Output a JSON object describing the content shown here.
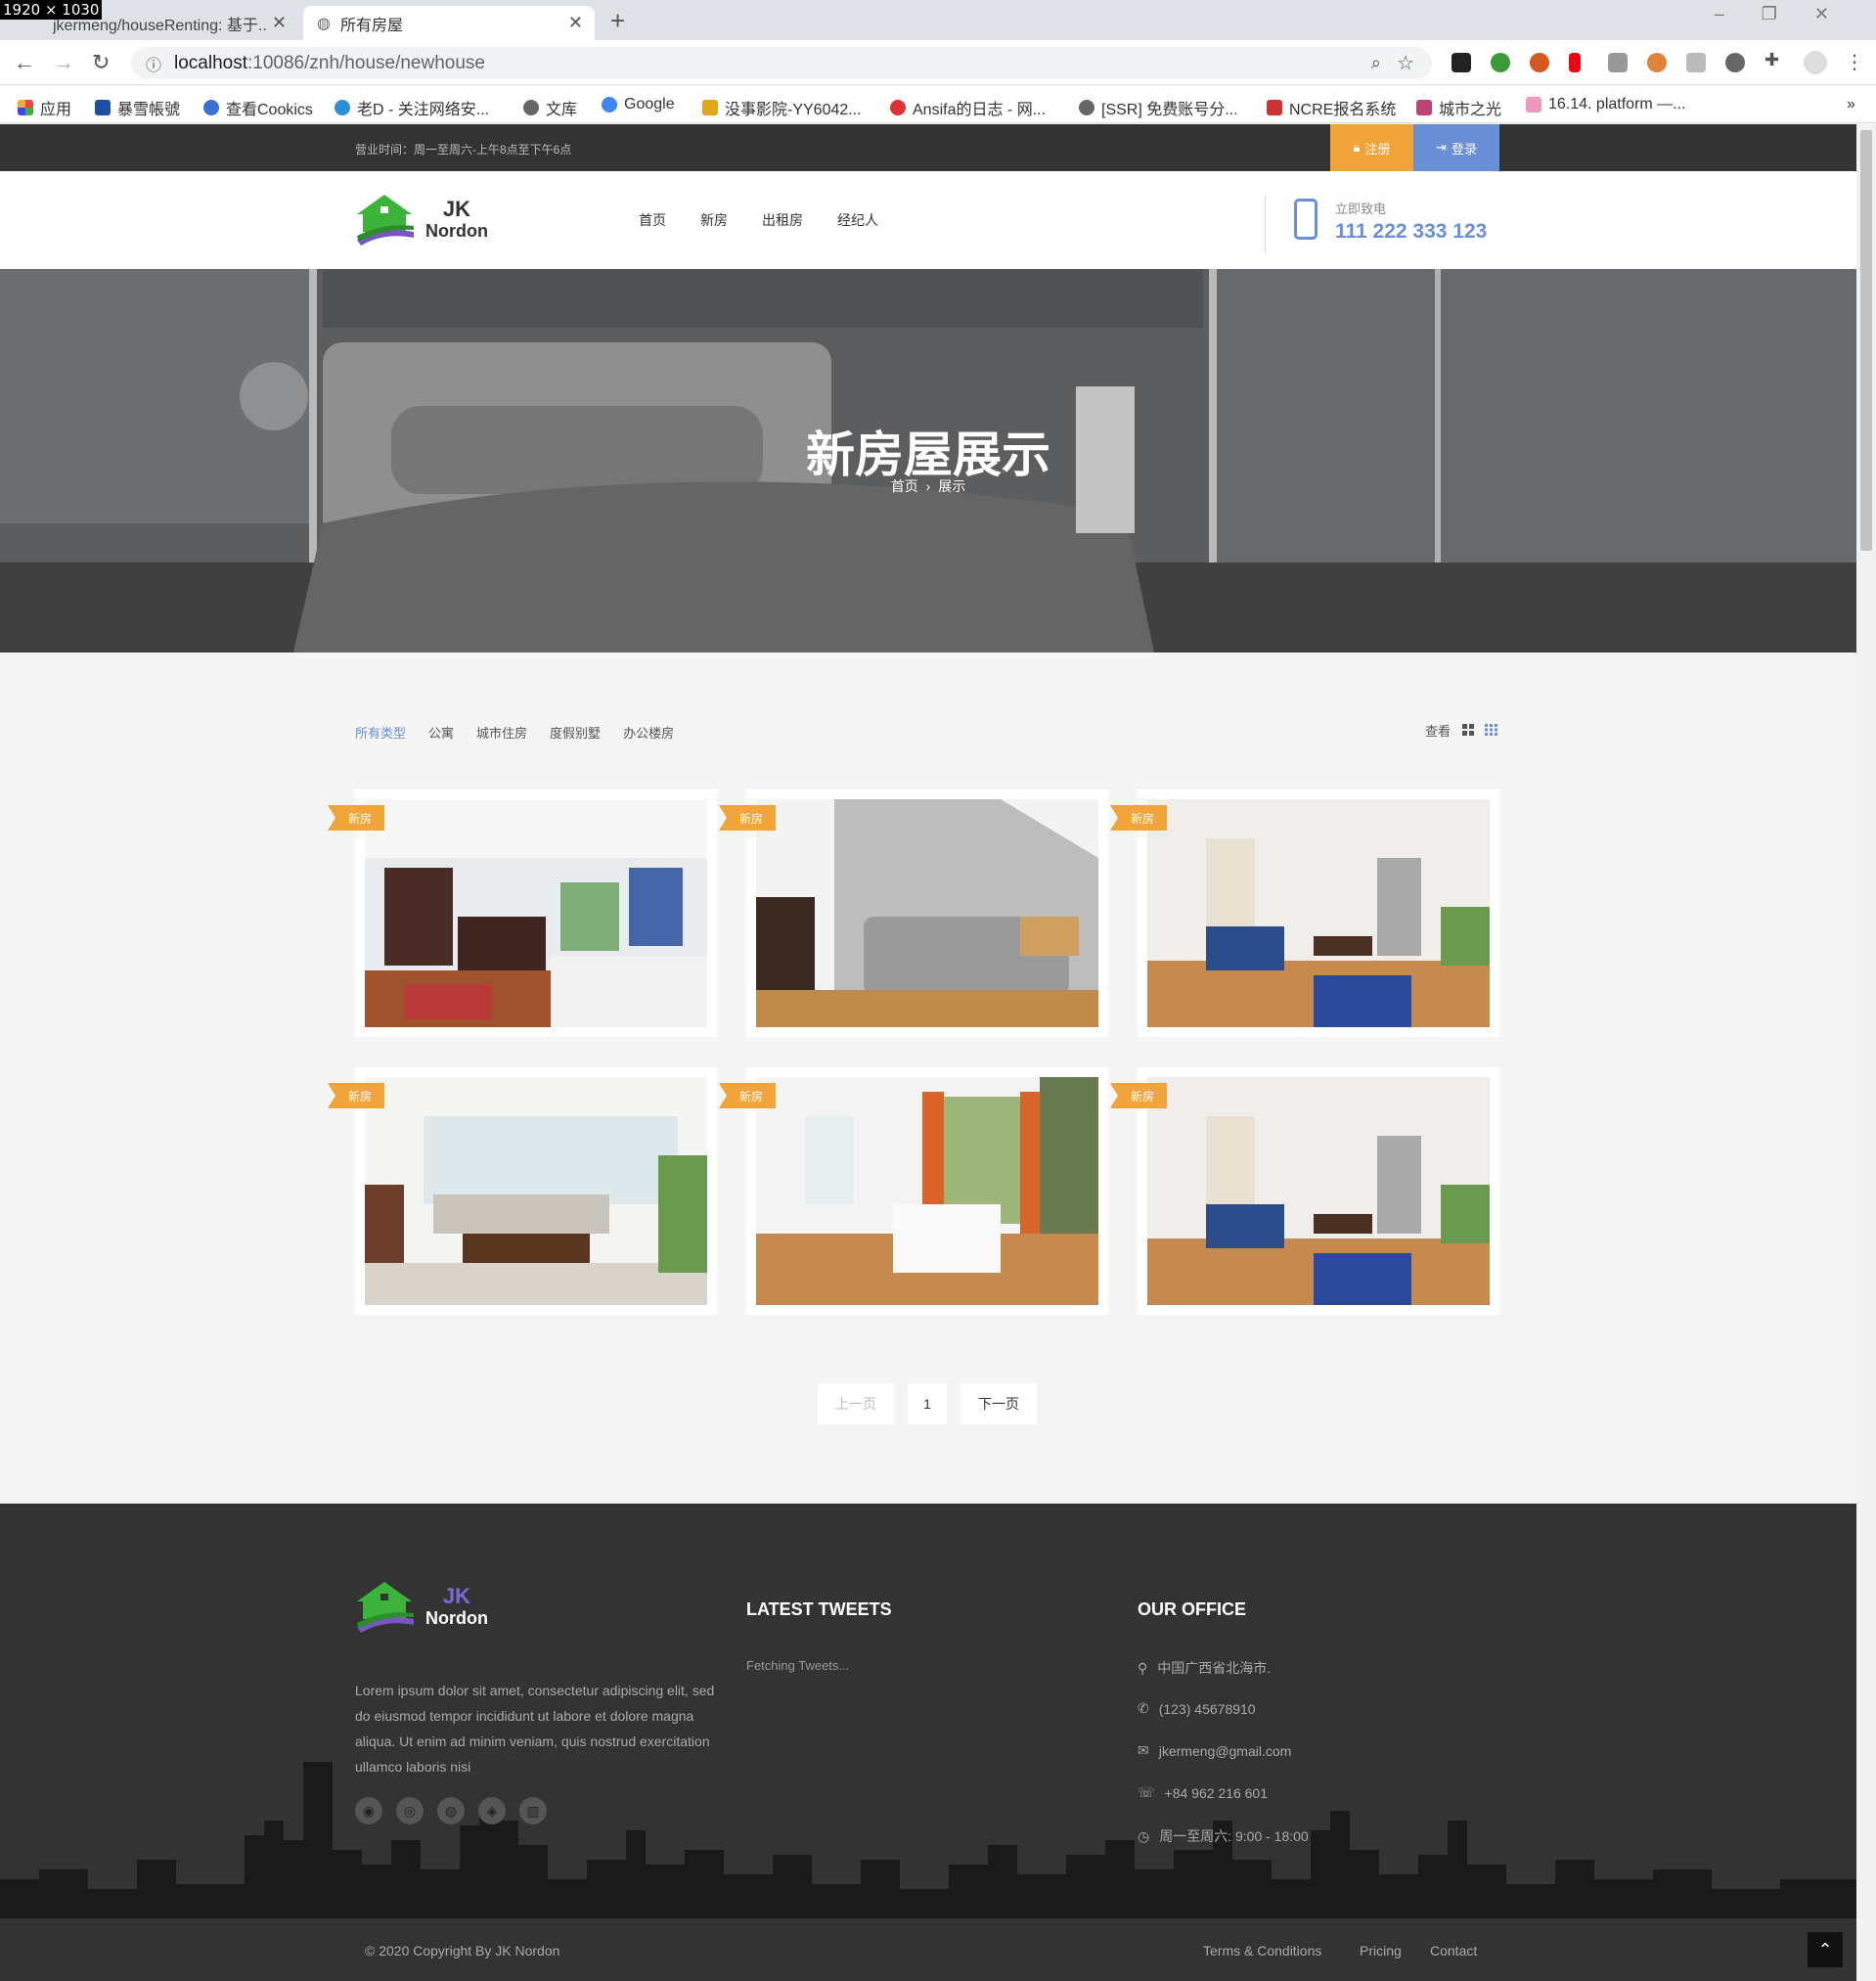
{
  "screen_size_label": "1920 × 1030",
  "browser": {
    "tabs": [
      {
        "label": "jkermeng/houseRenting: 基于..."
      },
      {
        "label": "所有房屋"
      }
    ],
    "url_host": "localhost",
    "url_path": ":10086/znh/house/newhouse",
    "bookmarks": [
      "应用",
      "暴雪帳號",
      "查看Cookics",
      "老D - 关注网络安...",
      "文库",
      "Google",
      "没事影院-YY6042...",
      "Ansifa的日志 - 网...",
      "[SSR] 免费账号分...",
      "NCRE报名系统",
      "城市之光",
      "16.14. platform —..."
    ],
    "bookmarks_more": "»"
  },
  "topbar": {
    "hours": "营业时间：周一至周六-上午8点至下午6点",
    "register": "注册",
    "login": "登录"
  },
  "header": {
    "logo_jk": "JK",
    "logo_nordon": "Nordon",
    "menu": [
      "首页",
      "新房",
      "出租房",
      "经纪人"
    ],
    "call_label": "立即致电",
    "call_number": "111 222 333 123"
  },
  "hero": {
    "title": "新房屋展示",
    "crumb_home": "首页",
    "crumb_sep": "›",
    "crumb_current": "展示"
  },
  "filters": [
    "所有类型",
    "公寓",
    "城市住房",
    "度假别墅",
    "办公楼房"
  ],
  "view_label": "查看",
  "listings": [
    {
      "badge": "新房",
      "scene": "kitchen"
    },
    {
      "badge": "新房",
      "scene": "bedroom"
    },
    {
      "badge": "新房",
      "scene": "living-striped"
    },
    {
      "badge": "新房",
      "scene": "living-bright"
    },
    {
      "badge": "新房",
      "scene": "dining"
    },
    {
      "badge": "新房",
      "scene": "living-striped"
    }
  ],
  "pagination": {
    "prev": "上一页",
    "current": "1",
    "next": "下一页"
  },
  "footer": {
    "logo_jk": "JK",
    "logo_nordon": "Nordon",
    "description": "Lorem ipsum dolor sit amet, consectetur adipiscing elit, sed do eiusmod tempor incididunt ut labore et dolore magna aliqua. Ut enim ad minim veniam, quis nostrud exercitation ullamco laboris nisi",
    "tweets_title": "LATEST TWEETS",
    "tweets_status": "Fetching Tweets...",
    "office_title": "OUR OFFICE",
    "office": {
      "address": "中国广西省北海市.",
      "phone": "(123) 45678910",
      "email": "jkermeng@gmail.com",
      "fax": "+84 962 216 601",
      "hours": "周一至周六: 9:00 - 18:00"
    },
    "copyright": "© 2020 Copyright By JK Nordon",
    "links": [
      "Terms & Conditions",
      "Pricing",
      "Contact"
    ]
  },
  "colors": {
    "accent_orange": "#f0a43a",
    "accent_blue": "#6a8fd6",
    "dark": "#333333"
  }
}
